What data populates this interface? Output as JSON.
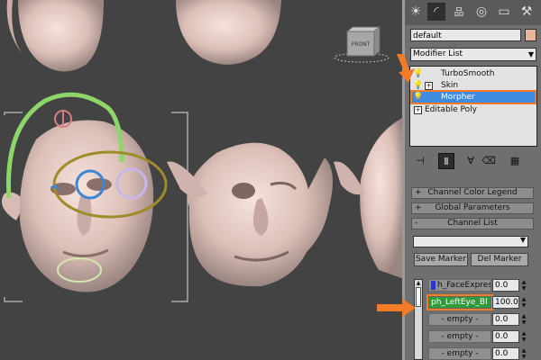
{
  "viewport": {
    "nav_cube_label": "FRONT"
  },
  "panel": {
    "tabs": [
      {
        "icon": "sun-icon",
        "glyph": "☀"
      },
      {
        "icon": "curve-icon",
        "glyph": "◜"
      },
      {
        "icon": "hierarchy-icon",
        "glyph": "品"
      },
      {
        "icon": "motion-icon",
        "glyph": "◎"
      },
      {
        "icon": "display-icon",
        "glyph": "▭"
      },
      {
        "icon": "hammer-icon",
        "glyph": "⚒"
      }
    ],
    "object_name": "default",
    "swatch_color": "#e6b59a",
    "modifier_list_label": "Modifier List",
    "stack": [
      {
        "label": "TurboSmooth",
        "has_plus": false,
        "selected": false
      },
      {
        "label": "Skin",
        "has_plus": true,
        "selected": false
      },
      {
        "label": "Morpher",
        "has_plus": false,
        "selected": true
      },
      {
        "label": "Editable Poly",
        "has_plus": true,
        "selected": false
      }
    ],
    "rollouts": [
      {
        "sign": "+",
        "label": "Channel Color Legend"
      },
      {
        "sign": "+",
        "label": "Global Parameters"
      },
      {
        "sign": "-",
        "label": "Channel List"
      }
    ],
    "save_marker": "Save Marker",
    "del_marker": "Del Marker",
    "channels": [
      {
        "name": "h_FaceExpress",
        "value": "0.0",
        "active": false,
        "empty": false
      },
      {
        "name": "ph_LeftEye_Bl",
        "value": "100.0",
        "active": true,
        "empty": false
      },
      {
        "name": "- empty -",
        "value": "0.0",
        "active": false,
        "empty": true
      },
      {
        "name": "- empty -",
        "value": "0.0",
        "active": false,
        "empty": true
      },
      {
        "name": "- empty -",
        "value": "0.0",
        "active": false,
        "empty": true
      }
    ]
  },
  "colors": {
    "highlight_orange": "#f57c26",
    "selection_blue": "#3f8cdf",
    "active_channel_green": "#2f9a3a"
  }
}
